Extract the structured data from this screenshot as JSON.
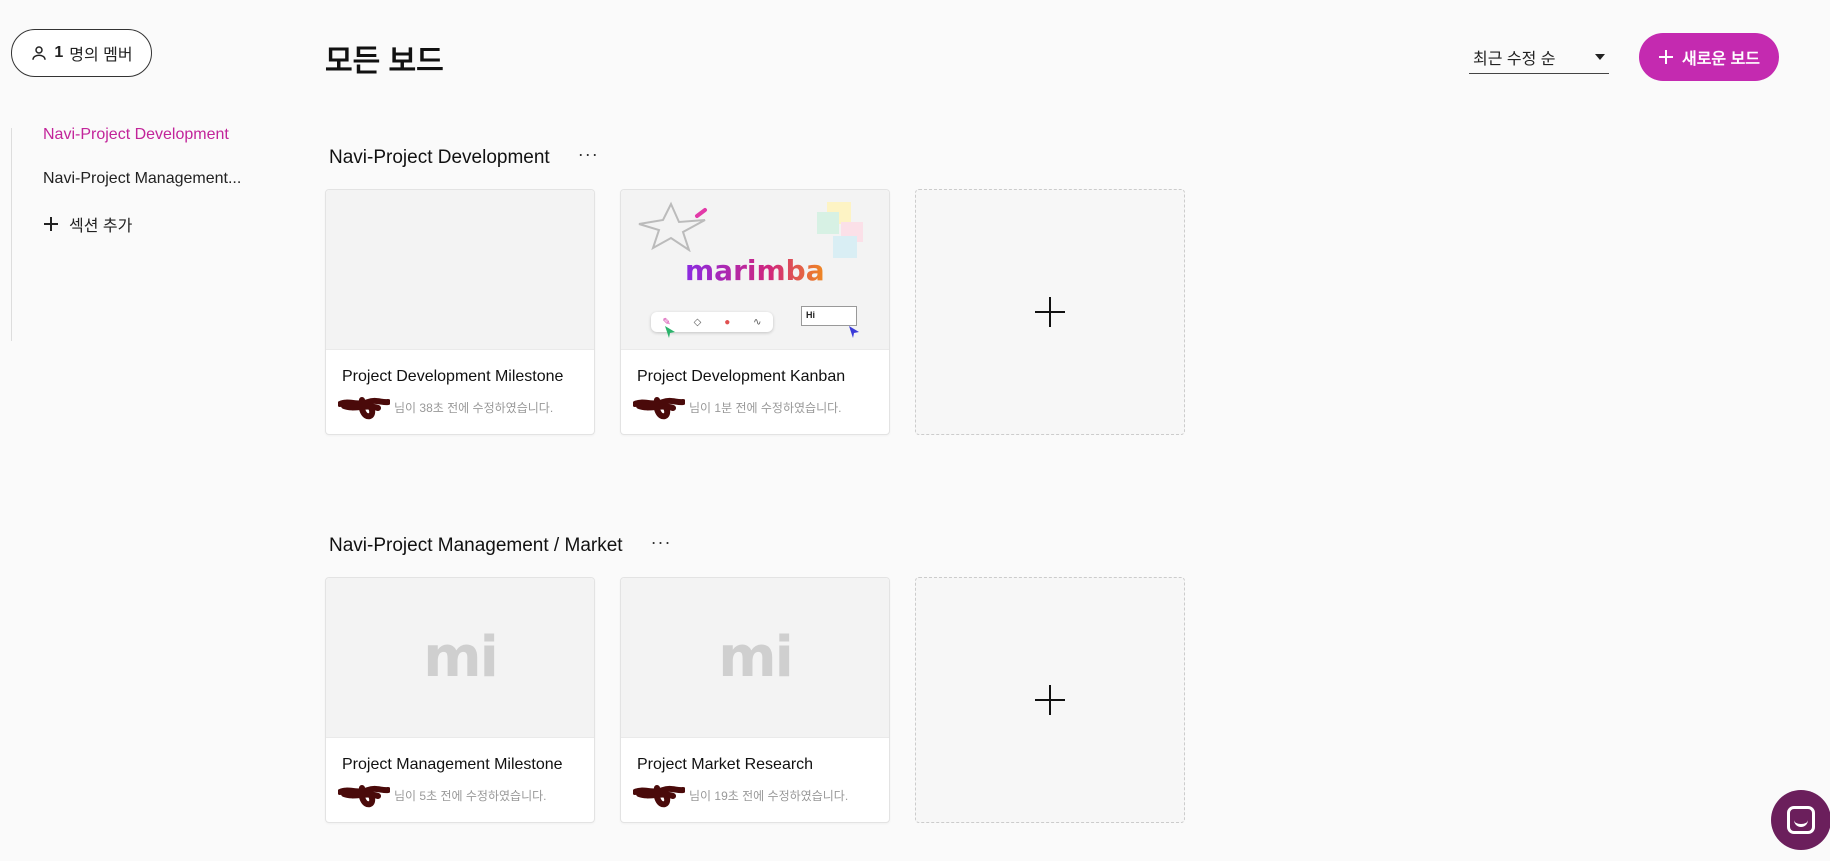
{
  "members": {
    "count": "1",
    "label": "명의 멤버"
  },
  "sidebar": {
    "items": [
      {
        "label": "Navi-Project Development",
        "active": true
      },
      {
        "label": "Navi-Project Management...",
        "active": false
      }
    ],
    "add_section_label": "섹션 추가"
  },
  "header": {
    "title": "모든 보드",
    "sort": {
      "selected": "최근 수정 순"
    },
    "new_board_label": "새로운 보드"
  },
  "sections": [
    {
      "title": "Navi-Project Development",
      "more": "···",
      "boards": [
        {
          "title": "Project Development Milestone",
          "meta": "님이 38초 전에 수정하였습니다.",
          "thumb": "blank"
        },
        {
          "title": "Project Development Kanban",
          "meta": "님이 1분 전에 수정하였습니다.",
          "thumb": "marimba"
        }
      ]
    },
    {
      "title": "Navi-Project Management / Market",
      "more": "···",
      "boards": [
        {
          "title": "Project Management Milestone",
          "meta": "님이 5초 전에 수정하였습니다.",
          "thumb": "mi"
        },
        {
          "title": "Project Market Research",
          "meta": "님이 19초 전에 수정하였습니다.",
          "thumb": "mi"
        }
      ]
    }
  ],
  "thumbnails": {
    "marimba_wordmark": "marimba",
    "mi_mark": "mi",
    "sticky_hi": "Hi"
  },
  "colors": {
    "accent": "#c42ab0",
    "active_text": "#c2249a",
    "redaction": "#4a0a0a",
    "chat": "#6b1f5c"
  },
  "icons": [
    "user-icon",
    "plus-icon",
    "caret-down-icon",
    "more-icon",
    "chat-icon"
  ]
}
